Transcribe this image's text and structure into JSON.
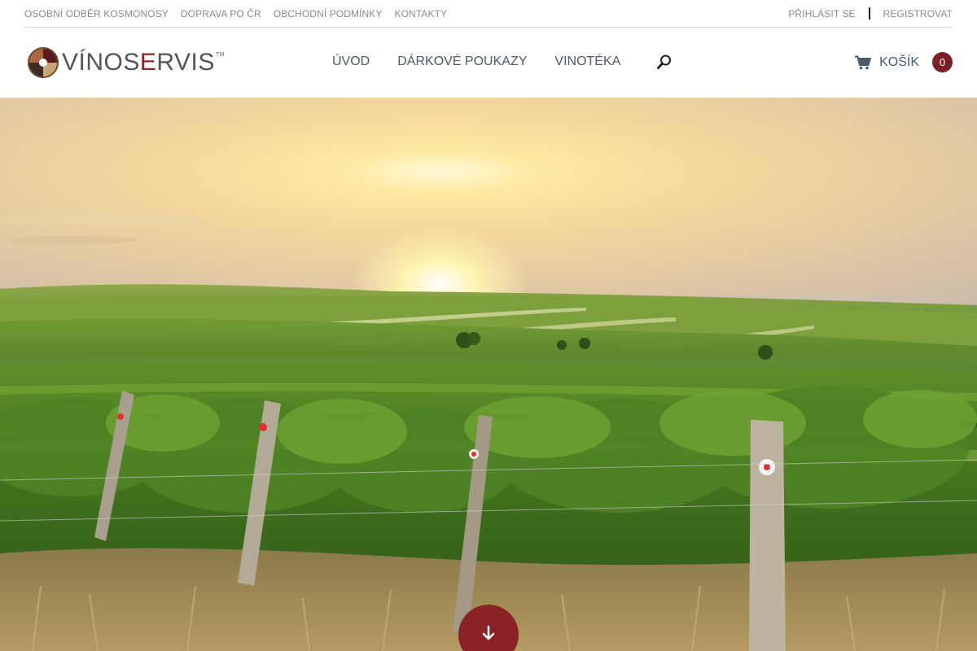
{
  "topbar": {
    "links": [
      "OSOBNÍ ODBĚR KOSMONOSY",
      "DOPRAVA PO ČR",
      "OBCHODNÍ PODMÍNKY",
      "KONTAKTY"
    ],
    "login": "PŘIHLÁSIT SE",
    "register": "REGISTROVAT"
  },
  "logo": {
    "text_pre": "VÍNOS",
    "text_accent": "E",
    "text_post": "RVIS",
    "tm": "TM"
  },
  "nav": {
    "items": [
      "ÚVOD",
      "DÁRKOVÉ POUKAZY",
      "VINOTÉKA"
    ],
    "search_icon": "search-icon"
  },
  "cart": {
    "label": "KOŠÍK",
    "count": "0",
    "icon": "cart-icon"
  },
  "hero": {
    "image": "vineyard at sunset",
    "scroll_icon": "arrow-down-icon"
  },
  "colors": {
    "brand": "#8b2226",
    "nav_text": "#4b5a6b",
    "topbar_text": "#8a8a8a"
  }
}
